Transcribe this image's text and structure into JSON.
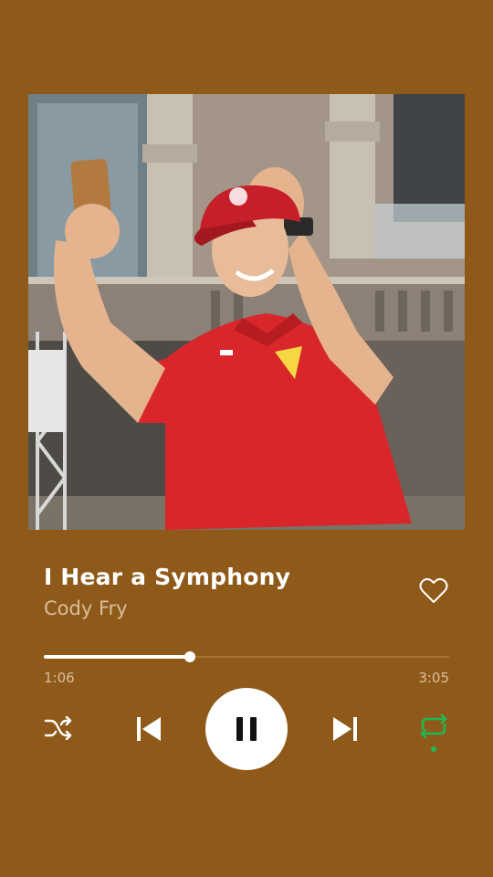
{
  "album_art": {
    "icon": "album-art-image"
  },
  "track": {
    "title": "I Hear a Symphony",
    "artist": "Cody Fry"
  },
  "playback": {
    "elapsed": "1:06",
    "total": "3:05",
    "progress_fraction": 0.36,
    "state": "playing",
    "repeat_active": true,
    "shuffle_active": false
  },
  "colors": {
    "background": "#8f5a19",
    "accent_active": "#1db954",
    "secondary_text": "#d8bf9e"
  }
}
